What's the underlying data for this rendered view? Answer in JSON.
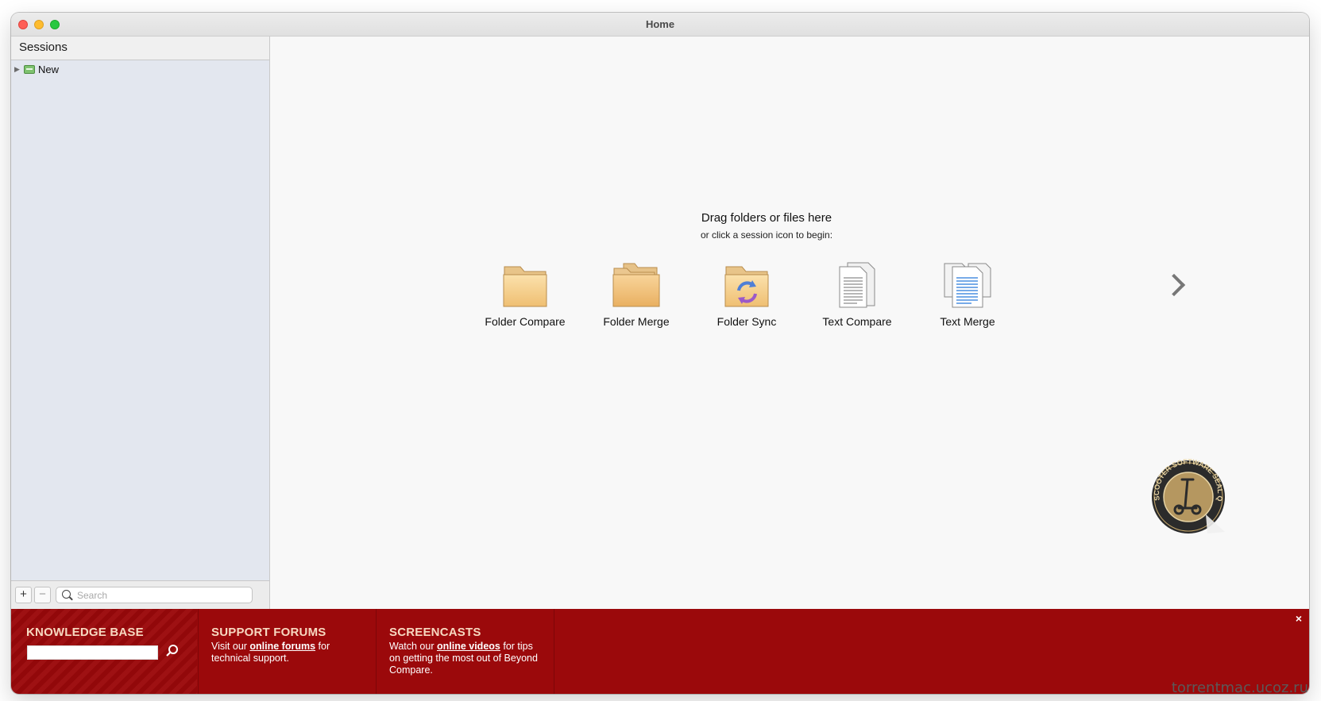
{
  "window": {
    "title": "Home"
  },
  "sidebar": {
    "header": "Sessions",
    "tree": [
      {
        "label": "New",
        "icon": "session-folder-icon"
      }
    ],
    "search_placeholder": "Search",
    "add_label": "+",
    "remove_label": "−"
  },
  "main": {
    "drag_title": "Drag folders or files here",
    "drag_subtitle": "or click a session icon to begin:",
    "sessions": [
      {
        "label": "Folder Compare",
        "icon": "folder-icon"
      },
      {
        "label": "Folder Merge",
        "icon": "folder-stack-icon"
      },
      {
        "label": "Folder Sync",
        "icon": "folder-sync-icon"
      },
      {
        "label": "Text Compare",
        "icon": "text-documents-icon"
      },
      {
        "label": "Text Merge",
        "icon": "text-merge-documents-icon"
      }
    ]
  },
  "banner": {
    "knowledge_base": {
      "heading": "KNOWLEDGE BASE"
    },
    "support_forums": {
      "heading": "SUPPORT FORUMS",
      "text_before": "Visit our ",
      "link": "online forums",
      "text_after": " for technical support."
    },
    "screencasts": {
      "heading": "SCREENCASTS",
      "text_before": "Watch our ",
      "link": "online videos",
      "text_after": " for tips on getting the most out of Beyond Compare."
    },
    "close_label": "×",
    "accent_color": "#9b090b"
  },
  "seal_text": "SCOOTER SOFTWARE SEAL QUALITY",
  "watermark": "torrentmac.ucoz.ru"
}
